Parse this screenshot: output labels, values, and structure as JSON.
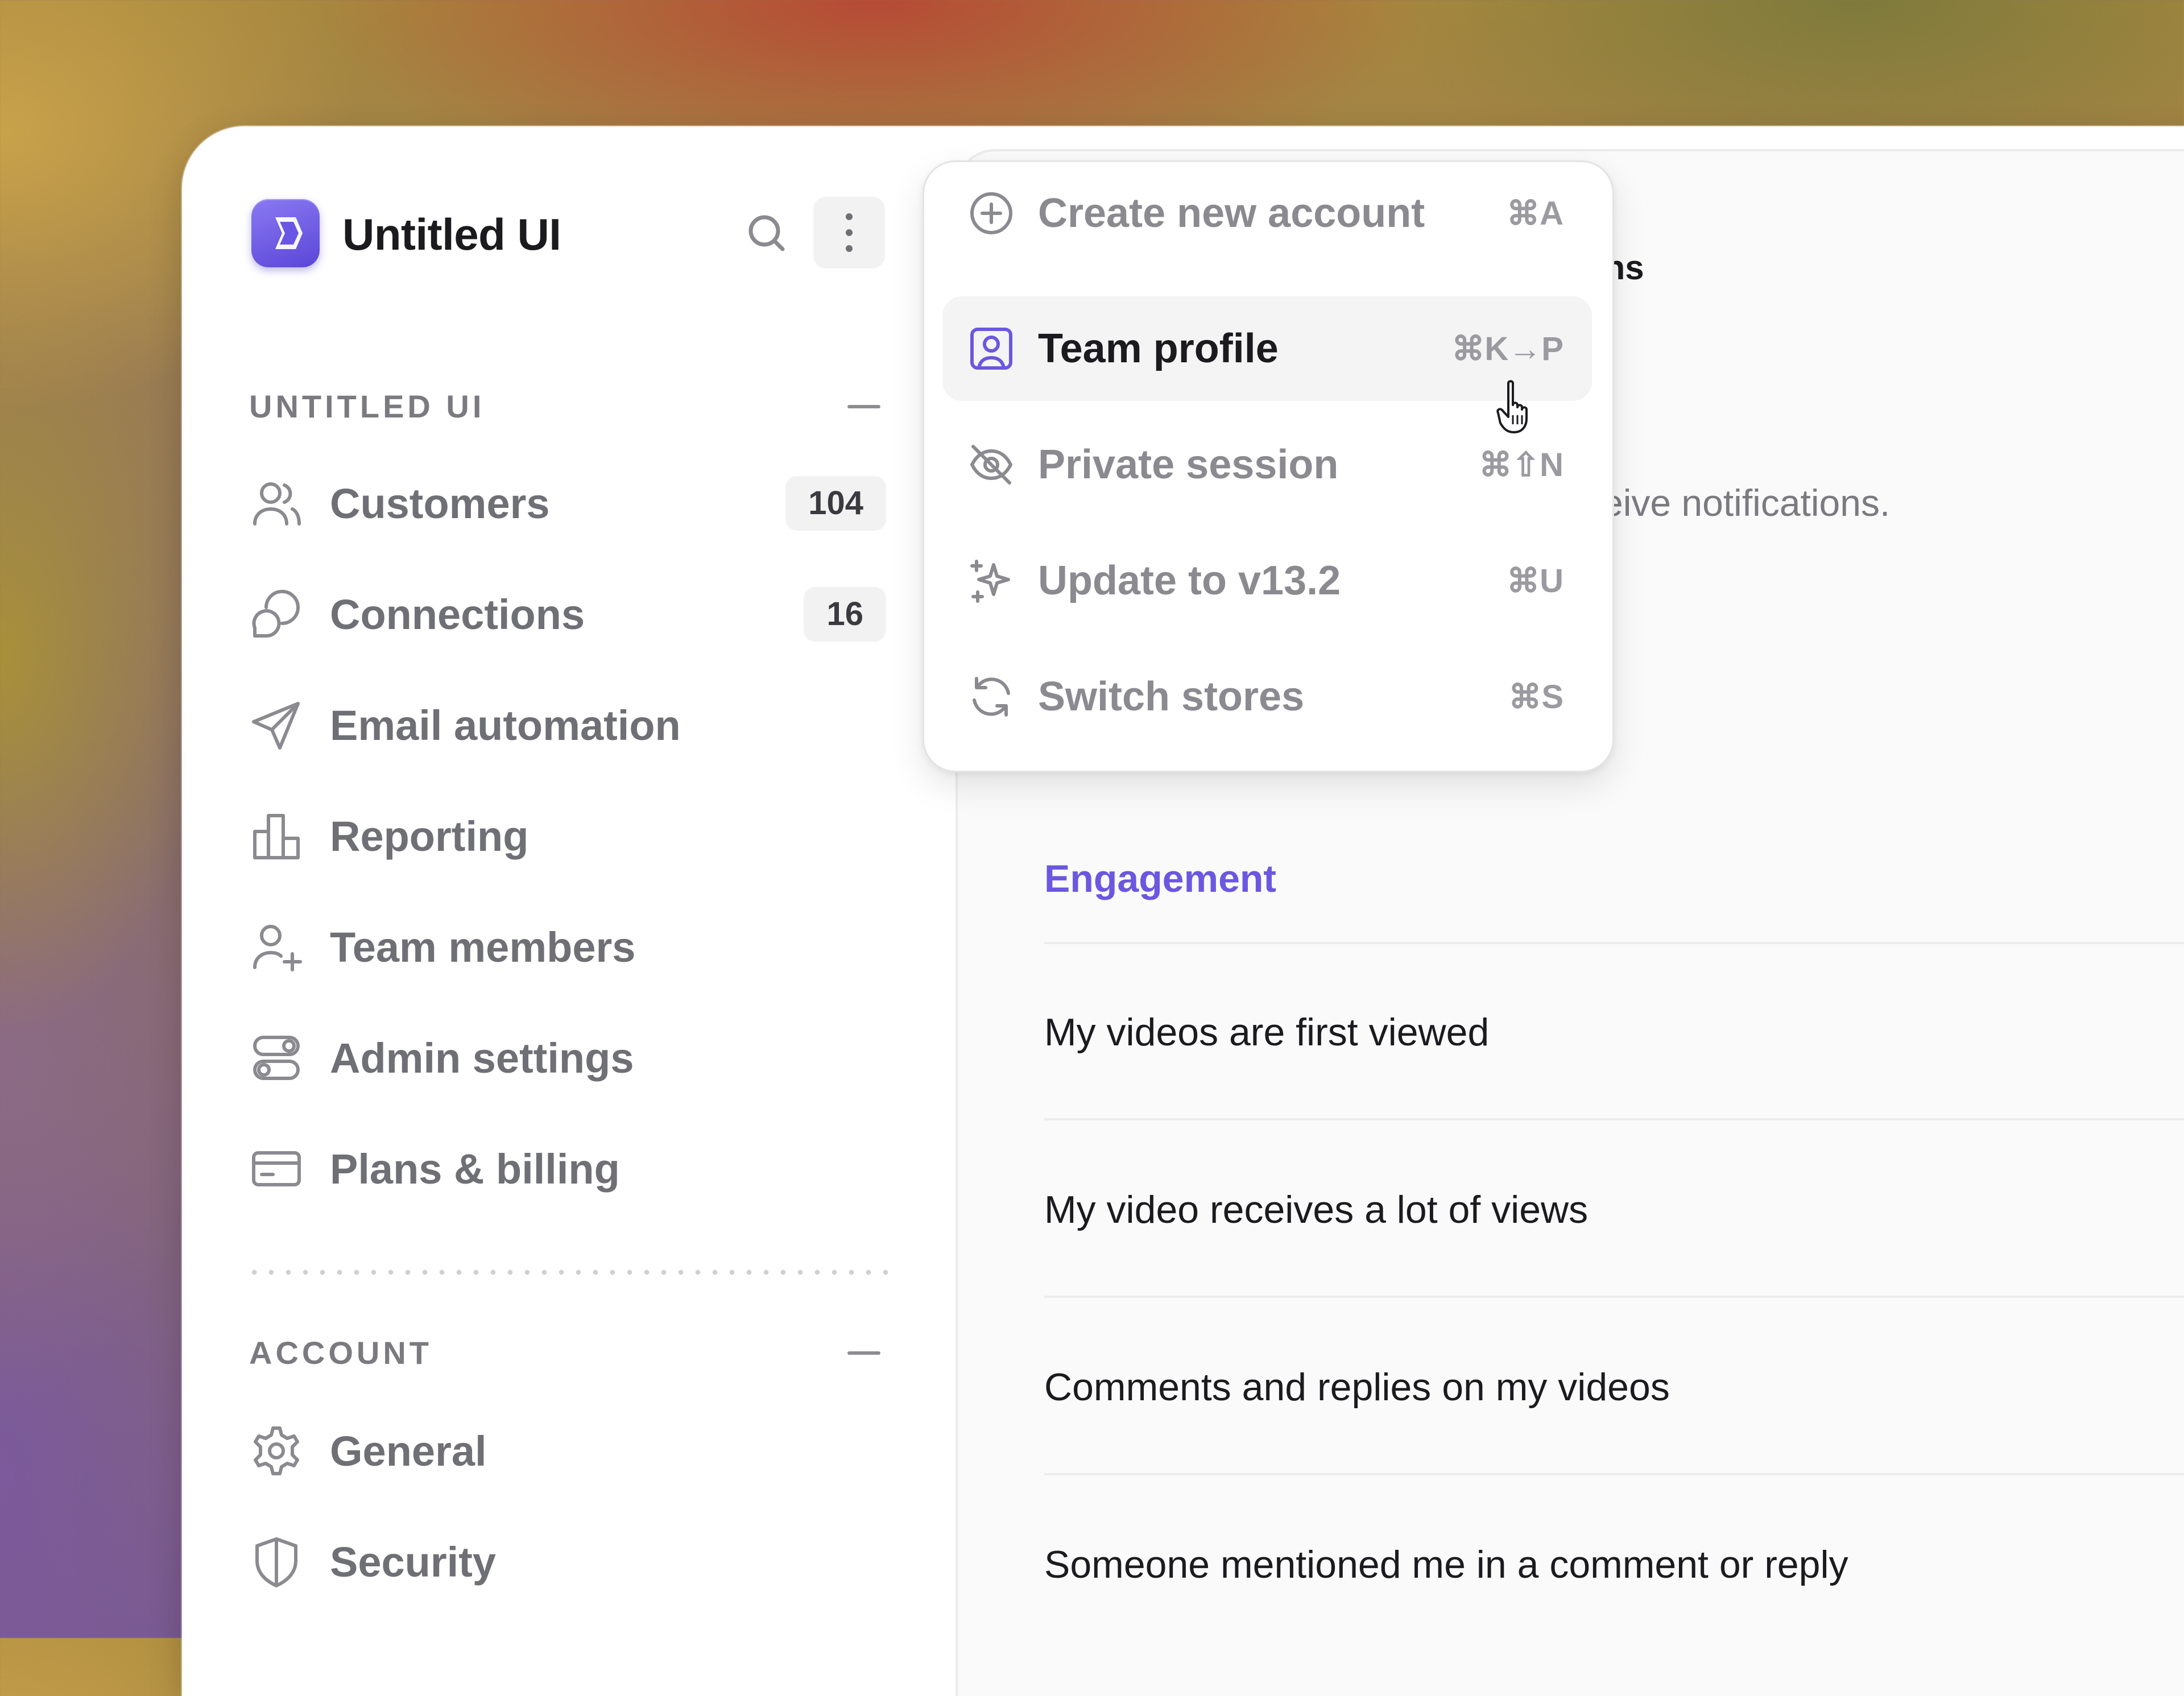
{
  "brand": {
    "name": "Untitled UI"
  },
  "sidebar": {
    "sections": [
      {
        "title": "UNTITLED UI",
        "items": [
          {
            "label": "Customers",
            "icon": "users-icon",
            "badge": "104"
          },
          {
            "label": "Connections",
            "icon": "message-chat-icon",
            "badge": "16"
          },
          {
            "label": "Email automation",
            "icon": "send-icon"
          },
          {
            "label": "Reporting",
            "icon": "bar-chart-icon"
          },
          {
            "label": "Team members",
            "icon": "user-plus-icon"
          },
          {
            "label": "Admin settings",
            "icon": "toggle-icon"
          },
          {
            "label": "Plans & billing",
            "icon": "credit-card-icon"
          }
        ]
      },
      {
        "title": "ACCOUNT",
        "items": [
          {
            "label": "General",
            "icon": "gear-icon"
          },
          {
            "label": "Security",
            "icon": "shield-icon"
          }
        ]
      }
    ]
  },
  "menu": {
    "items": [
      {
        "label": "Create new account",
        "shortcut": "⌘A",
        "icon": "plus-circle-icon"
      },
      {
        "label": "Team profile",
        "shortcut": "⌘K→P",
        "icon": "user-square-icon",
        "active": true
      },
      {
        "label": "Private session",
        "shortcut": "⌘⇧N",
        "icon": "eye-off-icon"
      },
      {
        "label": "Update to v13.2",
        "shortcut": "⌘U",
        "icon": "sparkle-icon"
      },
      {
        "label": "Switch stores",
        "shortcut": "⌘S",
        "icon": "refresh-icon"
      }
    ]
  },
  "main": {
    "heading_fragment": "ons",
    "subtext_fragment": "ceive notifications.",
    "group_title": "Engagement",
    "rows": [
      "My videos are first viewed",
      "My video receives a lot of views",
      "Comments and replies on my videos",
      "Someone mentioned me in a comment or reply"
    ]
  },
  "colors": {
    "accent": "#6b57e0",
    "brand_gradient_start": "#8a7af2",
    "brand_gradient_end": "#5a46d8",
    "text_primary": "#1b1b1f",
    "text_muted": "#6f6f76"
  }
}
